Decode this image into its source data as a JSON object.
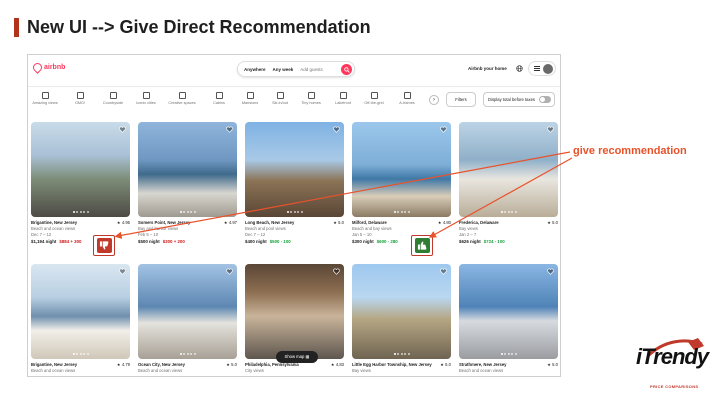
{
  "slide": {
    "title": "New UI --> Give Direct Recommendation",
    "annotation": "give recommendation",
    "accent_color": "#b1331c",
    "annotation_color": "#e8522b"
  },
  "app": {
    "logo_text": "airbnb",
    "brand_color": "#ff385c",
    "search": {
      "anywhere": "Anywhere",
      "any_week": "Any week",
      "add_guests": "Add guests"
    },
    "host_link": "Airbnb your home",
    "categories": [
      {
        "label": "Amazing views",
        "active": true
      },
      {
        "label": "OMG!",
        "active": false
      },
      {
        "label": "Countryside",
        "active": false
      },
      {
        "label": "Iconic cities",
        "active": false
      },
      {
        "label": "Creative spaces",
        "active": false
      },
      {
        "label": "Cabins",
        "active": false
      },
      {
        "label": "Mansions",
        "active": false
      },
      {
        "label": "Ski-in/out",
        "active": false
      },
      {
        "label": "Tiny homes",
        "active": false
      },
      {
        "label": "Lakefront",
        "active": false
      },
      {
        "label": "Off-the-grid",
        "active": false
      },
      {
        "label": "A-frames",
        "active": false
      }
    ],
    "filters_label": "Filters",
    "total_toggle_label": "Display total before taxes",
    "show_map_label": "Show map"
  },
  "listings": [
    {
      "location": "Brigantine, New Jersey",
      "rating": "4.95",
      "line1": "Beach and ocean views",
      "line2": "Dec 7 – 12",
      "price": "$1,194 night",
      "rec": "$884 + 300",
      "rec_type": "up"
    },
    {
      "location": "Somers Point, New Jersey",
      "rating": "4.97",
      "line1": "Bay and harbor views",
      "line2": "Feb 5 – 10",
      "price": "$500 night",
      "rec": "$300 + 200",
      "rec_type": "up"
    },
    {
      "location": "Long Beach, New Jersey",
      "rating": "5.0",
      "line1": "Beach and pool views",
      "line2": "Dec 7 – 12",
      "price": "$400 night",
      "rec": "$500 - 100",
      "rec_type": "down"
    },
    {
      "location": "Milford, Delaware",
      "rating": "4.80",
      "line1": "Beach and bay views",
      "line2": "Jan 5 – 10",
      "price": "$300 night",
      "rec": "$600 - 280",
      "rec_type": "down"
    },
    {
      "location": "Frederica, Delaware",
      "rating": "5.0",
      "line1": "Bay views",
      "line2": "Jan 2 – 7",
      "price": "$626 night",
      "rec": "$724 - 100",
      "rec_type": "down"
    },
    {
      "location": "Brigantine, New Jersey",
      "rating": "4.79",
      "line1": "Beach and ocean views",
      "line2": "",
      "price": "",
      "rec": "",
      "rec_type": ""
    },
    {
      "location": "Ocean City, New Jersey",
      "rating": "5.0",
      "line1": "Beach and ocean views",
      "line2": "",
      "price": "",
      "rec": "",
      "rec_type": ""
    },
    {
      "location": "Philadelphia, Pennsylvania",
      "rating": "4.83",
      "line1": "City views",
      "line2": "",
      "price": "",
      "rec": "",
      "rec_type": ""
    },
    {
      "location": "Little Egg Harbor Township, New Jersey",
      "rating": "5.0",
      "line1": "Bay views",
      "line2": "",
      "price": "",
      "rec": "",
      "rec_type": ""
    },
    {
      "location": "Strathmere, New Jersey",
      "rating": "5.0",
      "line1": "Beach and ocean views",
      "line2": "",
      "price": "",
      "rec": "",
      "rec_type": ""
    }
  ],
  "badges": {
    "down": {
      "icon": "thumbs-down-icon",
      "color": "#c0392b"
    },
    "up": {
      "icon": "thumbs-up-icon",
      "color": "#2f7d32"
    }
  },
  "brand_logo": {
    "name": "iTrendy",
    "tagline": "PRICE COMPARISONS"
  }
}
